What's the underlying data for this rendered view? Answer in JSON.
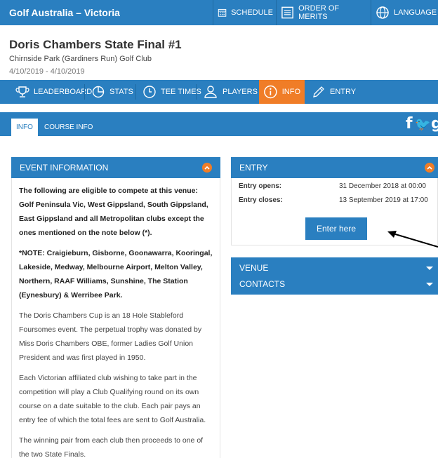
{
  "header": {
    "brand": "Golf Australia – Victoria",
    "nav": [
      {
        "label": "SCHEDULE",
        "icon": "calendar-icon"
      },
      {
        "label": "ORDER OF MERITS",
        "icon": "list-icon"
      },
      {
        "label": "LANGUAGE",
        "icon": "globe-icon"
      }
    ]
  },
  "event": {
    "title": "Doris Chambers State Final #1",
    "venue": "Chirnside Park (Gardiners Run) Golf Club",
    "dates": "4/10/2019 - 4/10/2019"
  },
  "main_nav": [
    {
      "label": "LEADERBOARD",
      "icon": "trophy-icon",
      "active": false
    },
    {
      "label": "STATS",
      "icon": "pie-chart-icon",
      "active": false
    },
    {
      "label": "TEE TIMES",
      "icon": "clock-icon",
      "active": false
    },
    {
      "label": "PLAYERS",
      "icon": "players-icon",
      "active": false
    },
    {
      "label": "INFO",
      "icon": "info-icon",
      "active": true
    },
    {
      "label": "ENTRY",
      "icon": "pen-icon",
      "active": false
    }
  ],
  "sub_nav": {
    "tabs": [
      {
        "label": "INFO",
        "active": true
      },
      {
        "label": "COURSE INFO",
        "active": false
      }
    ],
    "social": [
      {
        "glyph": "f",
        "icon": "facebook-icon"
      },
      {
        "glyph": "🐦",
        "icon": "twitter-icon"
      },
      {
        "glyph": "g",
        "icon": "google-plus-icon"
      }
    ]
  },
  "event_info": {
    "heading": "EVENT INFORMATION",
    "paragraphs": [
      {
        "text": "The following are eligible to compete at this venue: Golf Peninsula Vic, West Gippsland, South Gippsland, East Gippsland and all Metropolitan clubs except the ones mentioned on the note below (*).",
        "bold": true
      },
      {
        "text": "*NOTE: Craigieburn, Gisborne, Goonawarra, Kooringal, Lakeside, Medway, Melbourne Airport, Melton Valley, Northern, RAAF Williams, Sunshine, The Station (Eynesbury) & Werribee Park.",
        "bold": true
      },
      {
        "text": "The Doris Chambers Cup is an 18 Hole Stableford Foursomes event. The perpetual trophy was donated by Miss Doris Chambers OBE, former Ladies Golf Union President and was first played in 1950.",
        "bold": false
      },
      {
        "text": "Each Victorian affiliated club wishing to take part in the competition will play a Club Qualifying round on its own course on a date suitable to the club. Each pair pays an entry fee of which the total fees are sent to Golf Australia.",
        "bold": false
      },
      {
        "text": "The winning pair from each club then proceeds to one of the two State Finals.",
        "bold": false
      }
    ]
  },
  "entry": {
    "heading": "ENTRY",
    "opens_label": "Entry opens:",
    "opens_value": "31 December 2018 at 00:00",
    "closes_label": "Entry closes:",
    "closes_value": "13 September 2019 at 17:00",
    "button_label": "Enter here"
  },
  "venue_panel": {
    "heading": "VENUE"
  },
  "contacts_panel": {
    "heading": "CONTACTS"
  },
  "colors": {
    "primary": "#2a7fc0",
    "accent": "#f07d27",
    "annotation_arrow": "#000000"
  }
}
